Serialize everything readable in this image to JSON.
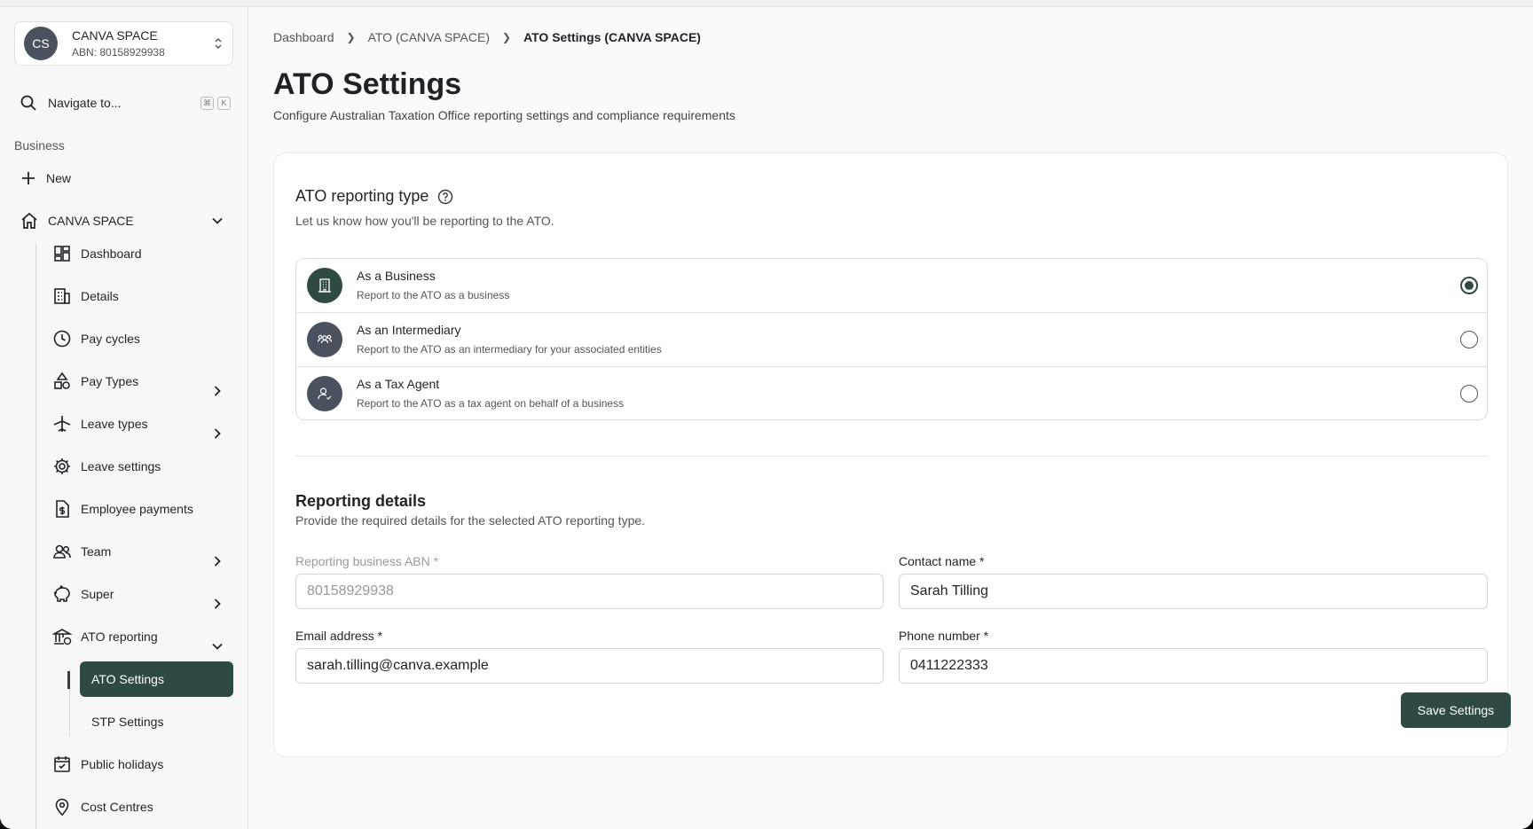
{
  "org": {
    "initials": "CS",
    "name": "CANVA SPACE",
    "abn": "ABN: 80158929938"
  },
  "nav_search": {
    "label": "Navigate to...",
    "kbd_cmd": "⌘",
    "kbd_k": "K"
  },
  "sidebar": {
    "section": "Business",
    "new_label": "New",
    "org_label": "CANVA SPACE",
    "items": [
      {
        "label": "Dashboard"
      },
      {
        "label": "Details"
      },
      {
        "label": "Pay cycles"
      },
      {
        "label": "Pay Types"
      },
      {
        "label": "Leave types"
      },
      {
        "label": "Leave settings"
      },
      {
        "label": "Employee payments"
      },
      {
        "label": "Team"
      },
      {
        "label": "Super"
      },
      {
        "label": "ATO reporting"
      },
      {
        "label": "Public holidays"
      },
      {
        "label": "Cost Centres"
      }
    ],
    "sub_items": [
      {
        "label": "ATO Settings"
      },
      {
        "label": "STP Settings"
      }
    ]
  },
  "breadcrumb": {
    "items": [
      "Dashboard",
      "ATO (CANVA SPACE)",
      "ATO Settings (CANVA SPACE)"
    ]
  },
  "page": {
    "title": "ATO Settings",
    "subtitle": "Configure Australian Taxation Office reporting settings and compliance requirements"
  },
  "reporting_type": {
    "heading": "ATO reporting type",
    "description": "Let us know how you'll be reporting to the ATO.",
    "options": [
      {
        "title": "As a Business",
        "desc": "Report to the ATO as a business",
        "selected": true
      },
      {
        "title": "As an Intermediary",
        "desc": "Report to the ATO as an intermediary for your associated entities",
        "selected": false
      },
      {
        "title": "As a Tax Agent",
        "desc": "Report to the ATO as a tax agent on behalf of a business",
        "selected": false
      }
    ]
  },
  "details": {
    "heading": "Reporting details",
    "description": "Provide the required details for the selected ATO reporting type.",
    "abn": {
      "label": "Reporting business ABN *",
      "value": "80158929938"
    },
    "contact": {
      "label": "Contact name *",
      "value": "Sarah Tilling"
    },
    "email": {
      "label": "Email address *",
      "value": "sarah.tilling@canva.example"
    },
    "phone": {
      "label": "Phone number *",
      "value": "0411222333"
    },
    "save_label": "Save Settings"
  },
  "colors": {
    "accent": "#2f4a45",
    "icon_inactive": "#4a5260"
  }
}
